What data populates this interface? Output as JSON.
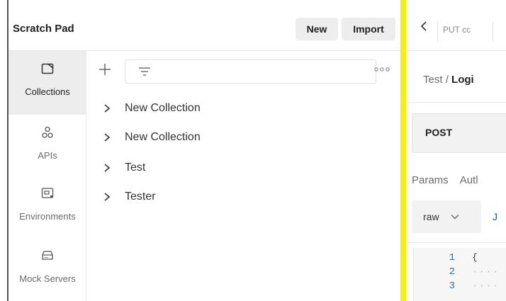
{
  "workspace": {
    "title": "Scratch Pad",
    "new_label": "New",
    "import_label": "Import"
  },
  "sidebar": {
    "items": [
      {
        "label": "Collections",
        "icon": "collection-icon",
        "active": true
      },
      {
        "label": "APIs",
        "icon": "apis-icon",
        "active": false
      },
      {
        "label": "Environments",
        "icon": "environment-icon",
        "active": false
      },
      {
        "label": "Mock Servers",
        "icon": "mock-server-icon",
        "active": false
      }
    ]
  },
  "collections": [
    {
      "name": "New Collection"
    },
    {
      "name": "New Collection"
    },
    {
      "name": "Test"
    },
    {
      "name": "Tester"
    }
  ],
  "request": {
    "tab_label": "PUT cc",
    "breadcrumb_parent": "Test",
    "breadcrumb_sep": "/",
    "breadcrumb_current": "Logi",
    "method": "POST",
    "tabs": [
      "Params",
      "Autl"
    ],
    "body_mode": "raw",
    "body_next": "J",
    "line_numbers": [
      "1",
      "2",
      "3"
    ],
    "code_first": "{"
  },
  "colors": {
    "highlight": "#f2f20d",
    "link": "#1a55c8"
  }
}
